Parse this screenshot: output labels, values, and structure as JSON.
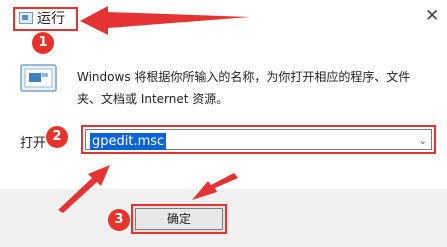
{
  "titlebar": {
    "title": "运行",
    "close_glyph": "✕"
  },
  "dialog": {
    "description": "Windows 将根据你所输入的名称，为你打开相应的程序、文件夹、文档或 Internet 资源。",
    "open_label": "打开",
    "command_value": "gpedit.msc",
    "ok_label": "确定"
  },
  "annotations": {
    "step1": "1",
    "step2": "2",
    "step3": "3"
  },
  "colors": {
    "annotation_red": "#e53333",
    "selection_blue": "#0a64d6"
  },
  "icons": [
    "run-icon",
    "close-icon",
    "chevron-down-icon"
  ]
}
